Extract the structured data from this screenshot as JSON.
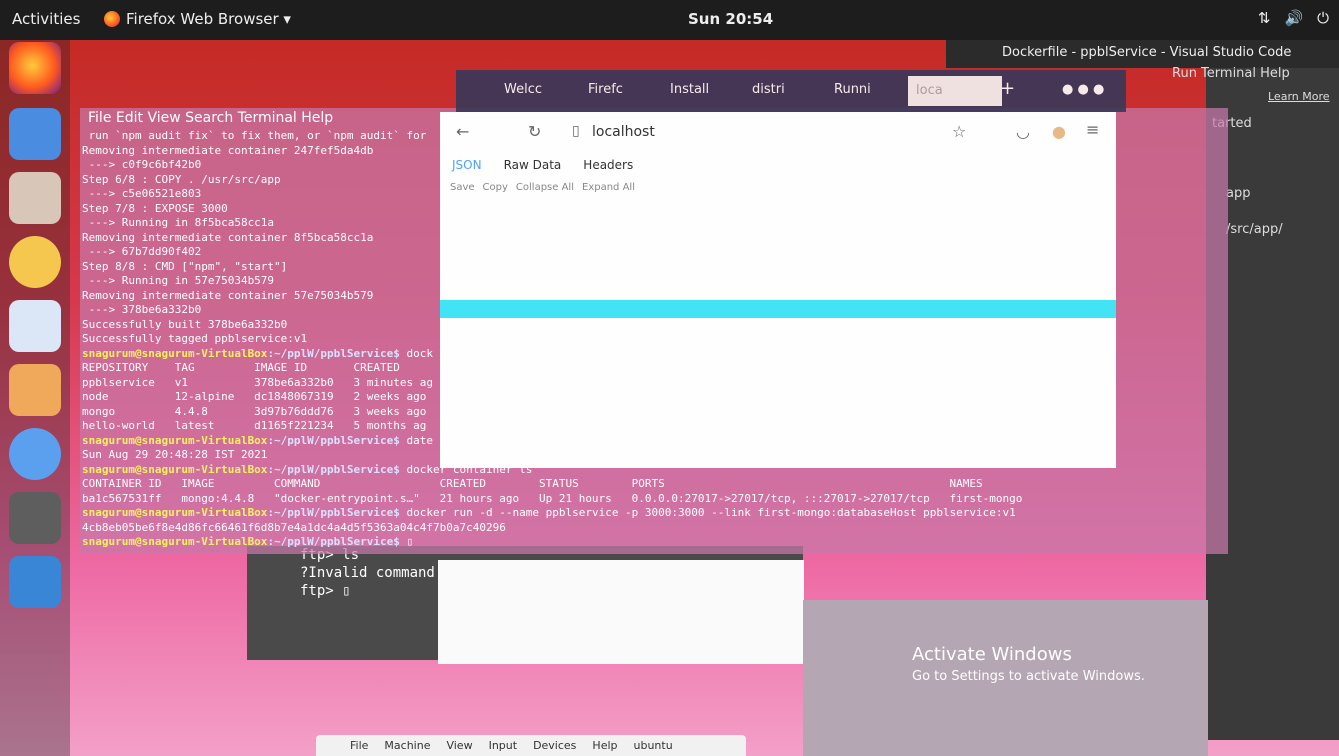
{
  "topbar": {
    "activities": "Activities",
    "app_name": "Firefox Web Browser ▾",
    "clock": "Sun 20:54",
    "tray_icons": [
      "network-icon",
      "volume-icon",
      "power-icon"
    ]
  },
  "vscode": {
    "title": "Dockerfile - ppblService - Visual Studio Code",
    "menu": "Run  Terminal  Help",
    "learn_more": "Learn More",
    "started": "tarted",
    "app_line": "app",
    "src_line": "/src/app/"
  },
  "terminal": {
    "menu": "File  Edit  View  Search  Terminal  Help",
    "lines": [
      " run `npm audit fix` to fix them, or `npm audit` for",
      "Removing intermediate container 247fef5da4db",
      " ---> c0f9c6bf42b0",
      "Step 6/8 : COPY . /usr/src/app",
      " ---> c5e06521e803",
      "Step 7/8 : EXPOSE 3000",
      " ---> Running in 8f5bca58cc1a",
      "Removing intermediate container 8f5bca58cc1a",
      " ---> 67b7dd90f402",
      "Step 8/8 : CMD [\"npm\", \"start\"]",
      " ---> Running in 57e75034b579",
      "Removing intermediate container 57e75034b579",
      " ---> 378be6a332b0",
      "Successfully built 378be6a332b0",
      "Successfully tagged ppblservice:v1"
    ],
    "prompt_user": "snagurum@snagurum-VirtualBox",
    "prompt_path": ":~/pplW/ppblService$",
    "cmd1": " dock",
    "images_header": "REPOSITORY    TAG         IMAGE ID       CREATED",
    "images_rows": [
      "ppblservice   v1          378be6a332b0   3 minutes ag",
      "node          12-alpine   dc1848067319   2 weeks ago",
      "mongo         4.4.8       3d97b76ddd76   3 weeks ago",
      "hello-world   latest      d1165f221234   5 months ag"
    ],
    "cmd2": " date",
    "date_output": "Sun Aug 29 20:48:28 IST 2021",
    "cmd3": " docker container ls",
    "ps_header": "CONTAINER ID   IMAGE         COMMAND                  CREATED        STATUS        PORTS                                           NAMES",
    "ps_row": "ba1c567531ff   mongo:4.4.8   \"docker-entrypoint.s…\"   21 hours ago   Up 21 hours   0.0.0.0:27017->27017/tcp, :::27017->27017/tcp   first-mongo",
    "cmd4": " docker run -d --name ppblservice -p 3000:3000 --link first-mongo:databaseHost ppblservice:v1",
    "run_output": "4cb8eb05be6f8e4d86fc66461f6d8b7e4a1dc4a4d5f5363a04c4f7b0a7c40296",
    "cursor": " ▯"
  },
  "ftp": {
    "lines": [
      "ftp> ls",
      "?Invalid command",
      "ftp> ▯"
    ]
  },
  "firefox": {
    "tabs": [
      "Welcc",
      "Firefc",
      "Install",
      "distri",
      "Runni",
      "loca"
    ],
    "url": "localhost",
    "dev_tabs": [
      "JSON",
      "Raw Data",
      "Headers"
    ],
    "actions": [
      "Save",
      "Copy",
      "Collapse All",
      "Expand All"
    ]
  },
  "activate": {
    "title": "Activate Windows",
    "subtitle": "Go to Settings to activate Windows."
  },
  "vbox": {
    "menu": [
      "File",
      "Machine",
      "View",
      "Input",
      "Devices",
      "Help",
      "ubuntu"
    ]
  }
}
